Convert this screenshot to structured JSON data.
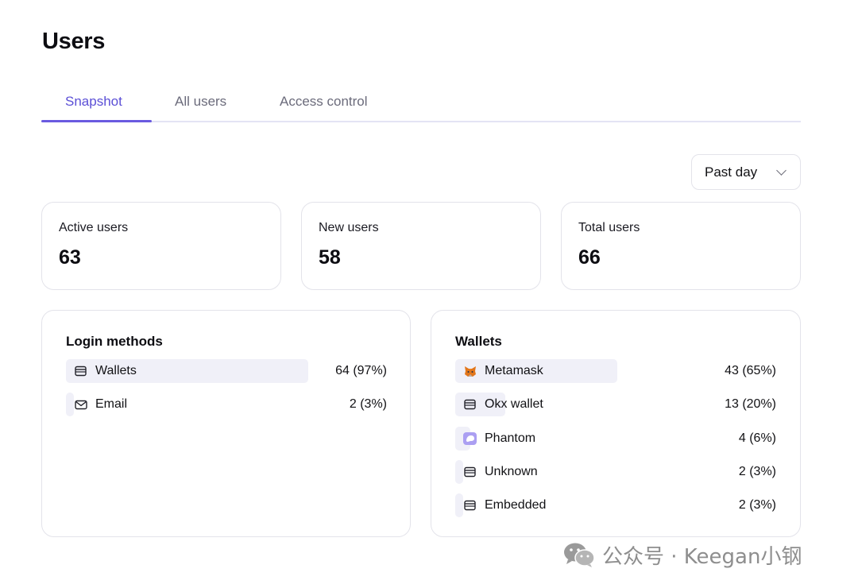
{
  "page": {
    "title": "Users"
  },
  "tabs": [
    {
      "label": "Snapshot",
      "active": true
    },
    {
      "label": "All users",
      "active": false
    },
    {
      "label": "Access control",
      "active": false
    }
  ],
  "range_select": {
    "value": "Past day",
    "icon": "chevron-down-icon"
  },
  "stats": [
    {
      "label": "Active users",
      "value": "63"
    },
    {
      "label": "New users",
      "value": "58"
    },
    {
      "label": "Total users",
      "value": "66"
    }
  ],
  "login_methods": {
    "title": "Login methods",
    "items": [
      {
        "label": "Wallets",
        "value": "64 (97%)",
        "share": 0.97,
        "icon": "wallet-icon"
      },
      {
        "label": "Email",
        "value": "2 (3%)",
        "share": 0.03,
        "icon": "mail-icon"
      }
    ]
  },
  "wallets": {
    "title": "Wallets",
    "items": [
      {
        "label": "Metamask",
        "value": "43 (65%)",
        "share": 0.65,
        "icon": "metamask-fox-icon"
      },
      {
        "label": "Okx wallet",
        "value": "13 (20%)",
        "share": 0.2,
        "icon": "wallet-icon"
      },
      {
        "label": "Phantom",
        "value": "4 (6%)",
        "share": 0.06,
        "icon": "phantom-ghost-icon"
      },
      {
        "label": "Unknown",
        "value": "2 (3%)",
        "share": 0.03,
        "icon": "wallet-icon"
      },
      {
        "label": "Embedded",
        "value": "2 (3%)",
        "share": 0.03,
        "icon": "wallet-icon"
      }
    ]
  },
  "colors": {
    "accent": "#5b4fd6",
    "bar": "#f0f0f8",
    "border": "#e3e3ea",
    "phantom": "#ab9ff2"
  },
  "watermark": {
    "text": "公众号 · Keegan小钢",
    "icon": "wechat-icon"
  }
}
